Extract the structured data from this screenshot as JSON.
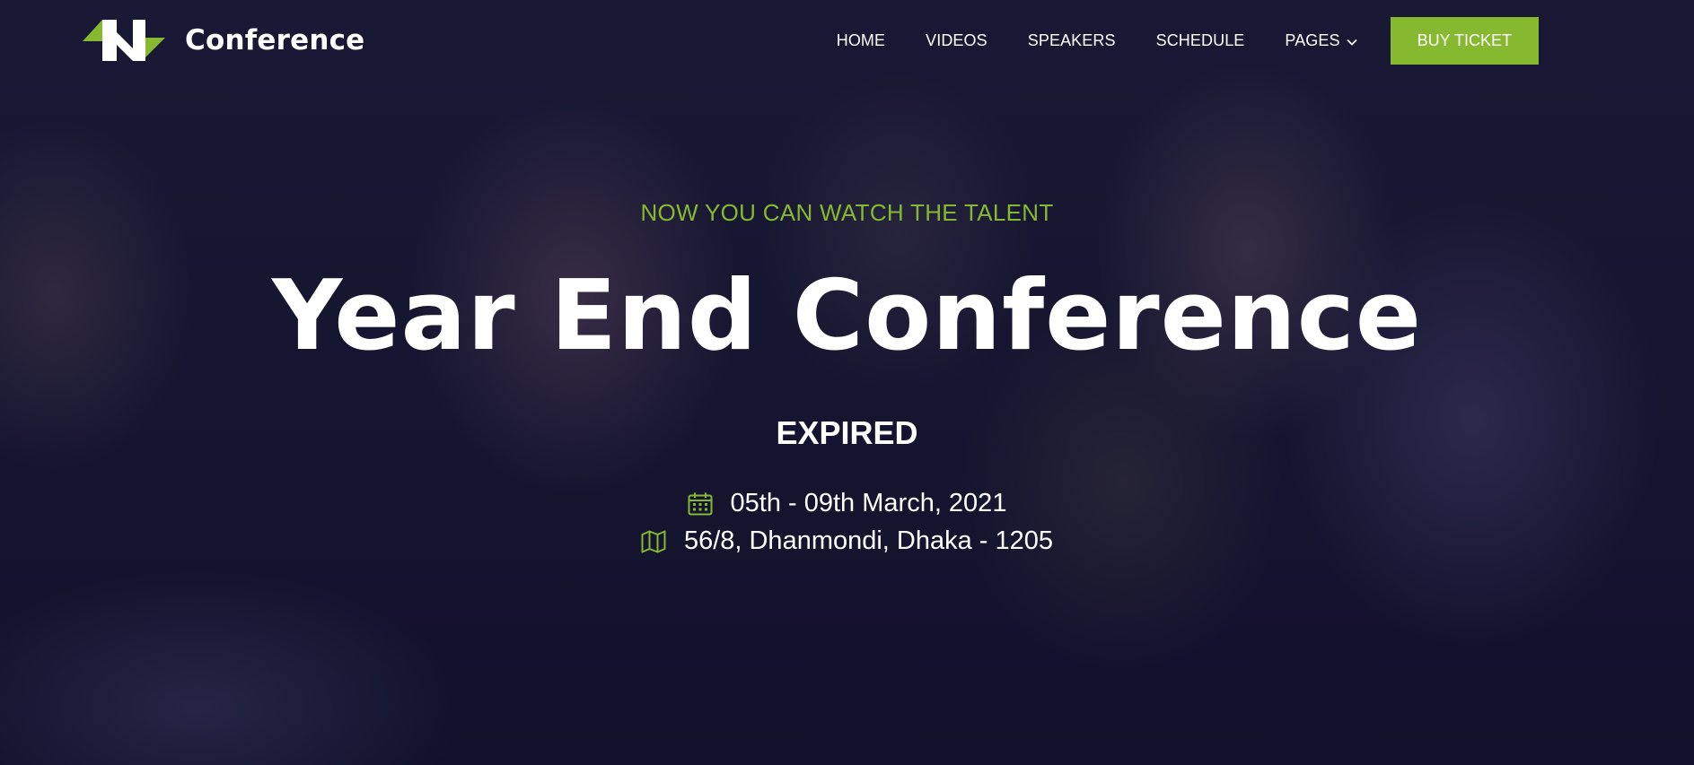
{
  "brand": {
    "name": "Conference",
    "accent": "#86b92f"
  },
  "nav": {
    "items": [
      "HOME",
      "VIDEOS",
      "SPEAKERS",
      "SCHEDULE",
      "PAGES"
    ],
    "cta": "BUY TICKET"
  },
  "hero": {
    "kicker": "NOW YOU CAN WATCH THE TALENT",
    "title": "Year End Conference",
    "status": "EXPIRED",
    "date": "05th - 09th March, 2021",
    "location": "56/8, Dhanmondi, Dhaka - 1205"
  },
  "icons": {
    "date": "calendar-icon",
    "location": "map-icon",
    "dropdown": "chevron-down-icon"
  }
}
